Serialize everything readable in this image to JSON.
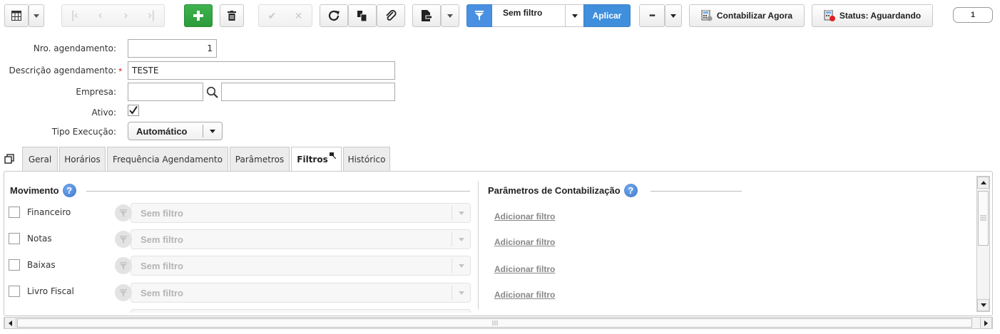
{
  "toolbar": {
    "filter_label": "Sem filtro",
    "apply_label": "Aplicar",
    "more_label": "•••",
    "contabilizar_label": "Contabilizar Agora",
    "status_label": "Status: Aguardando",
    "page_number": "1"
  },
  "form": {
    "nro_label": "Nro. agendamento:",
    "nro_value": "1",
    "descricao_label": "Descrição agendamento:",
    "descricao_required": "*",
    "descricao_value": "TESTE",
    "empresa_label": "Empresa:",
    "empresa_code": "",
    "empresa_name": "",
    "ativo_label": "Ativo:",
    "ativo_checked": true,
    "tipo_label": "Tipo Execução:",
    "tipo_value": "Automático"
  },
  "tabs": [
    {
      "label": "Geral"
    },
    {
      "label": "Horários"
    },
    {
      "label": "Frequência Agendamento"
    },
    {
      "label": "Parâmetros"
    },
    {
      "label": "Filtros",
      "active": true
    },
    {
      "label": "Histórico"
    }
  ],
  "movimento": {
    "title": "Movimento",
    "help": "?",
    "rows": [
      {
        "label": "Financeiro",
        "filter": "Sem filtro"
      },
      {
        "label": "Notas",
        "filter": "Sem filtro"
      },
      {
        "label": "Baixas",
        "filter": "Sem filtro"
      },
      {
        "label": "Livro Fiscal",
        "filter": "Sem filtro"
      }
    ]
  },
  "parametros": {
    "title": "Parâmetros de Contabilização",
    "help": "?",
    "links": [
      "Adicionar filtro",
      "Adicionar filtro",
      "Adicionar filtro",
      "Adicionar filtro"
    ]
  },
  "colors": {
    "green": "#2c9b3b",
    "blue": "#3f8fdc",
    "required": "#e03b3b"
  }
}
